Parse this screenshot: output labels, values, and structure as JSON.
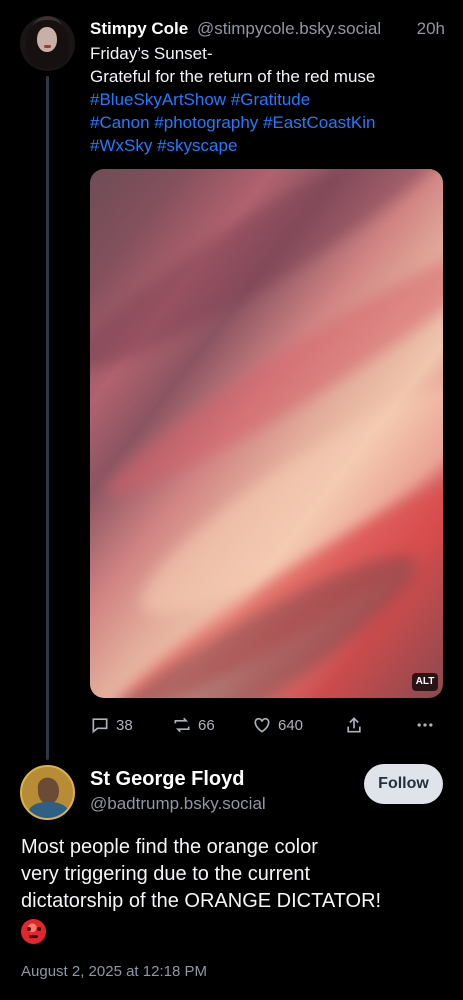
{
  "post1": {
    "author_name": "Stimpy Cole",
    "author_handle": "@stimpycole.bsky.social",
    "time": "20h",
    "text_lines": [
      "Friday’s Sunset-",
      "Grateful for the return of the red muse"
    ],
    "hashtag_lines": [
      [
        "#BlueSkyArtShow",
        "#Gratitude"
      ],
      [
        "#Canon",
        "#photography",
        "#EastCoastKin"
      ],
      [
        "#WxSky",
        "#skyscape"
      ]
    ],
    "alt_label": "ALT",
    "actions": {
      "replies": "38",
      "reposts": "66",
      "likes": "640"
    },
    "icons": [
      "reply-icon",
      "repost-icon",
      "like-icon",
      "share-icon",
      "more-icon"
    ]
  },
  "post2": {
    "author_name": "St George Floyd",
    "author_handle": "@badtrump.bsky.social",
    "follow_label": "Follow",
    "text_lines": [
      "Most people find the orange color",
      "very triggering due to the current",
      "dictatorship of the ORANGE DICTATOR!"
    ],
    "date": "August 2, 2025 at 12:18 PM"
  },
  "colors": {
    "background": "#000000",
    "link": "#1f7cff",
    "secondary_text": "#8e97a4",
    "follow_button": "#dfe4ea"
  }
}
